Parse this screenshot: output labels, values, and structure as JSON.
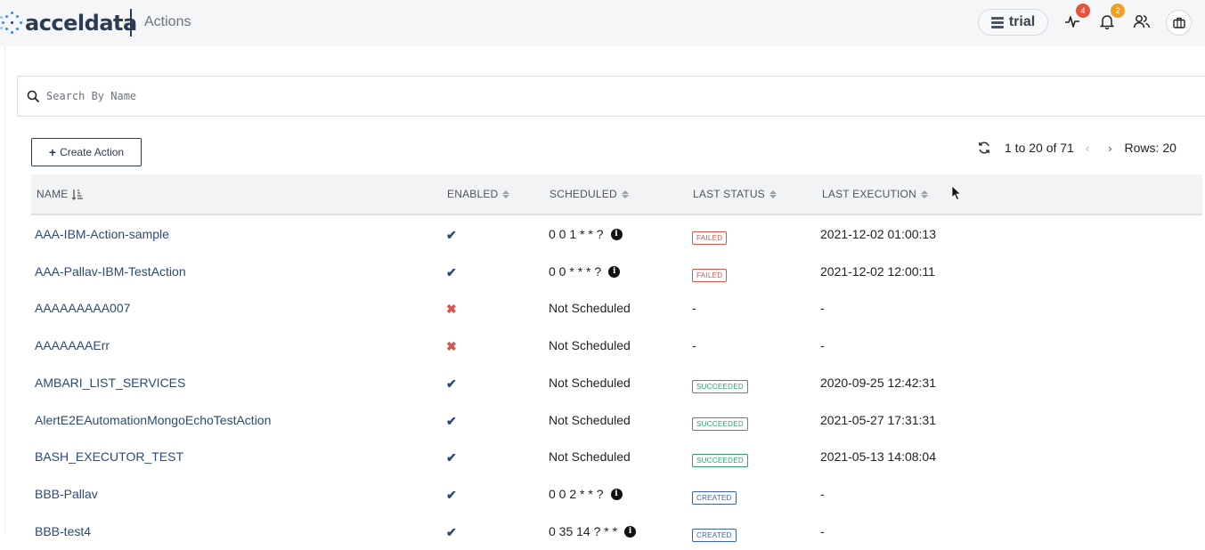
{
  "header": {
    "brand": "acceldata",
    "title": "Actions",
    "env_label": "trial",
    "pulse_badge": "4",
    "bell_badge": "2"
  },
  "search": {
    "placeholder": "Search By Name",
    "value": ""
  },
  "toolbar": {
    "create_label": "Create Action",
    "range_text": "1 to 20 of 71",
    "rows_label": "Rows: 20"
  },
  "table": {
    "columns": {
      "name": "NAME",
      "enabled": "ENABLED",
      "scheduled": "SCHEDULED",
      "last_status": "LAST STATUS",
      "last_execution": "LAST EXECUTION"
    },
    "rows": [
      {
        "name": "AAA-IBM-Action-sample",
        "enabled": true,
        "scheduled": "0 0 1 * * ?",
        "has_info": true,
        "status": "FAILED",
        "status_kind": "failed",
        "last_execution": "2021-12-02 01:00:13"
      },
      {
        "name": "AAA-Pallav-IBM-TestAction",
        "enabled": true,
        "scheduled": "0 0 * * * ?",
        "has_info": true,
        "status": "FAILED",
        "status_kind": "failed",
        "last_execution": "2021-12-02 12:00:11"
      },
      {
        "name": "AAAAAAAAA007",
        "enabled": false,
        "scheduled": "Not Scheduled",
        "has_info": false,
        "status": "-",
        "status_kind": "none",
        "last_execution": "-"
      },
      {
        "name": "AAAAAAAErr",
        "enabled": false,
        "scheduled": "Not Scheduled",
        "has_info": false,
        "status": "-",
        "status_kind": "none",
        "last_execution": "-"
      },
      {
        "name": "AMBARI_LIST_SERVICES",
        "enabled": true,
        "scheduled": "Not Scheduled",
        "has_info": false,
        "status": "SUCCEEDED",
        "status_kind": "succeeded",
        "last_execution": "2020-09-25 12:42:31"
      },
      {
        "name": "AlertE2EAutomationMongoEchoTestAction",
        "enabled": true,
        "scheduled": "Not Scheduled",
        "has_info": false,
        "status": "SUCCEEDED",
        "status_kind": "succeeded",
        "last_execution": "2021-05-27 17:31:31"
      },
      {
        "name": "BASH_EXECUTOR_TEST",
        "enabled": true,
        "scheduled": "Not Scheduled",
        "has_info": false,
        "status": "SUCCEEDED",
        "status_kind": "succeeded",
        "last_execution": "2021-05-13 14:08:04"
      },
      {
        "name": "BBB-Pallav",
        "enabled": true,
        "scheduled": "0 0 2 * * ?",
        "has_info": true,
        "status": "CREATED",
        "status_kind": "created",
        "last_execution": "-"
      },
      {
        "name": "BBB-test4",
        "enabled": true,
        "scheduled": "0 35 14 ? * *",
        "has_info": true,
        "status": "CREATED",
        "status_kind": "created",
        "last_execution": "-"
      }
    ]
  },
  "colors": {
    "brand": "#2b3a55",
    "link": "#2b4a78",
    "failed": "#d9534f",
    "succeeded": "#2e9e6b",
    "created": "#3a63a8"
  }
}
